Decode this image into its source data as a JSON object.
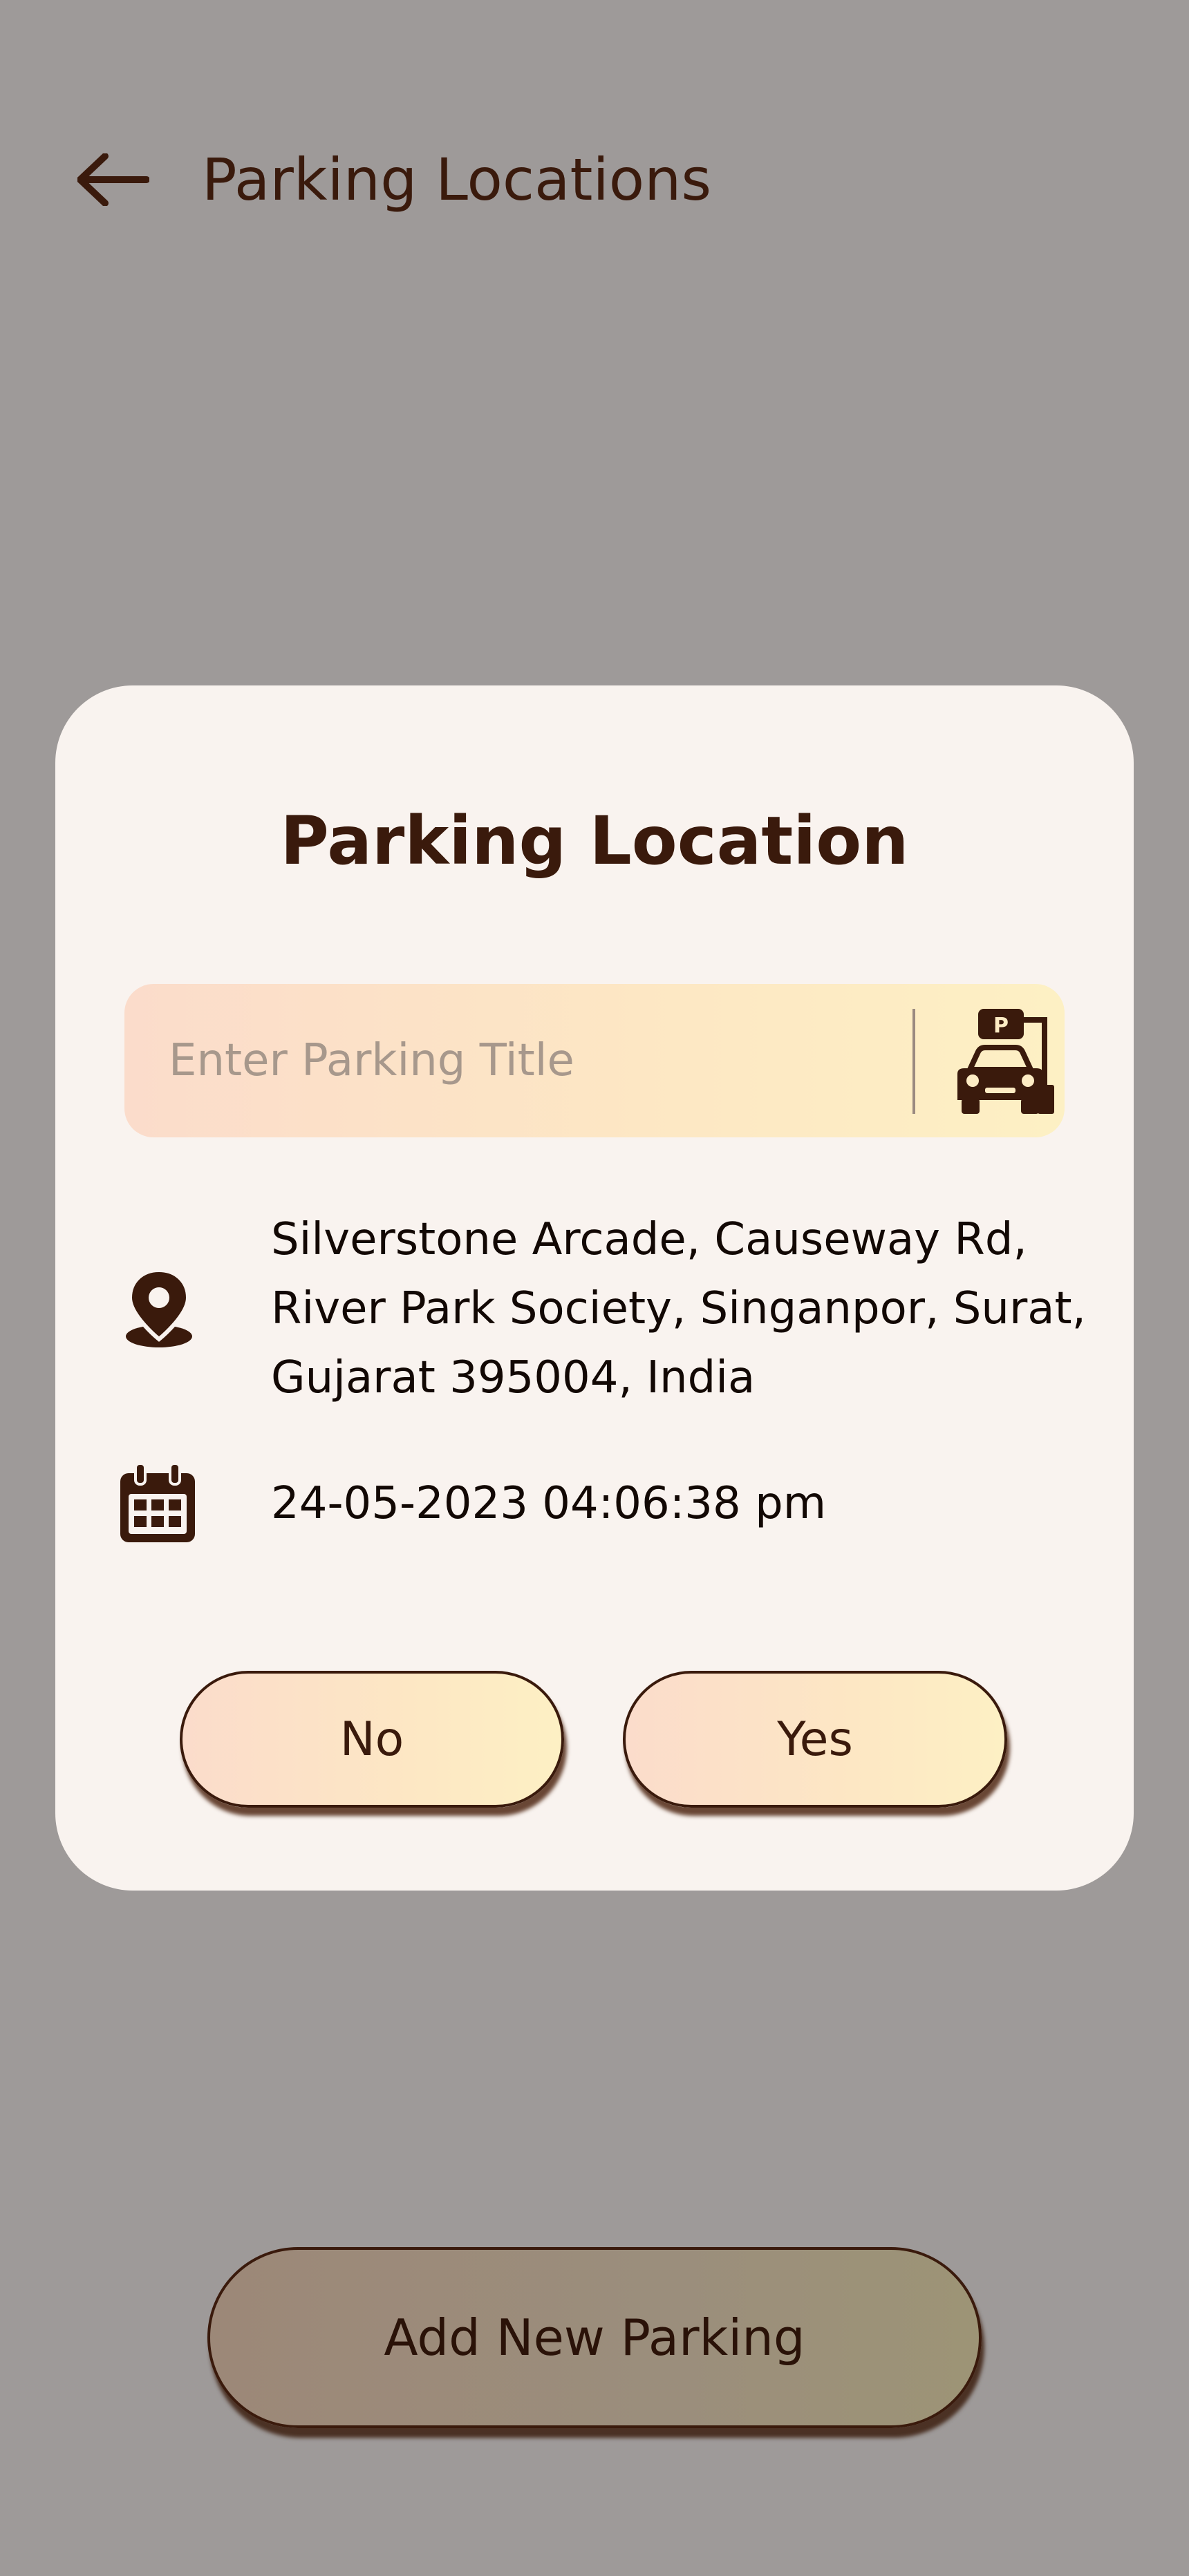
{
  "header": {
    "back_icon": "arrow-left-icon",
    "title": "Parking Locations"
  },
  "dialog": {
    "title": "Parking Location",
    "title_input": {
      "placeholder": "Enter Parking Title",
      "value": ""
    },
    "parking_icon": "car-parking-icon",
    "location_icon": "location-pin-icon",
    "address_lines": [
      "Silverstone Arcade, Causeway Rd,",
      "River Park Society, Singanpor, Surat,",
      "Gujarat 395004, India"
    ],
    "calendar_icon": "calendar-icon",
    "datetime": "24-05-2023 04:06:38 pm",
    "buttons": {
      "no_label": "No",
      "yes_label": "Yes"
    }
  },
  "footer": {
    "add_button_label": "Add New Parking"
  },
  "colors": {
    "overlay_background": "#9e9a99",
    "dialog_background": "#f9f3ef",
    "primary_text": "#3a1a0c",
    "gradient_start": "#fbdccb",
    "gradient_end": "#fdf0c4"
  }
}
